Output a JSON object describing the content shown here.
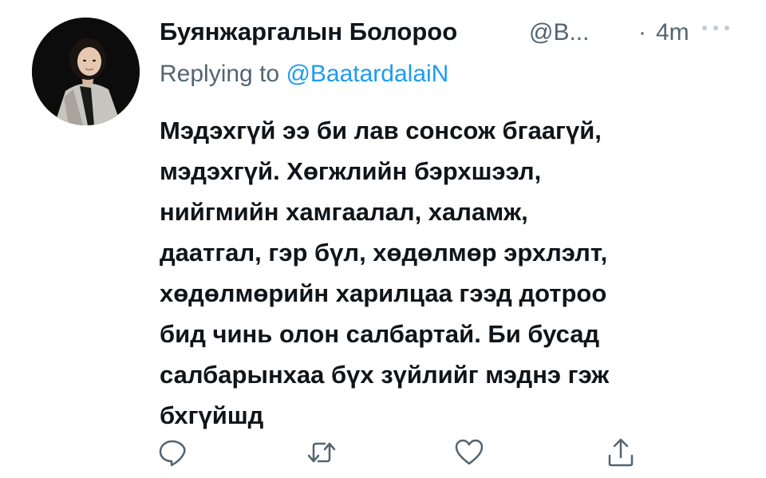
{
  "tweet": {
    "author_name": "Буянжаргалын Болороо",
    "author_handle": "@B...",
    "separator": "·",
    "timestamp": "4m",
    "reply_prefix": "Replying to",
    "reply_to": "@BaatardalaiN",
    "body_lines": [
      "Мэдэхгүй ээ би лав сонсож бгаагүй,",
      "мэдэхгүй. Хөгжлийн бэрхшээл,",
      "нийгмийн хамгаалал, халамж,",
      "даатгал, гэр бүл, хөдөлмөр эрхлэлт,",
      "хөдөлмөрийн харилцаа гээд дотроо",
      "бид чинь олон салбартай. Би бусад",
      "салбарынхаа бүх зүйлийг мэднэ гэж",
      "бхгүйшд"
    ]
  },
  "actions": {
    "reply_icon": "reply-icon",
    "retweet_icon": "retweet-icon",
    "like_icon": "heart-icon",
    "share_icon": "share-icon"
  },
  "colors": {
    "text": "#0f1419",
    "secondary": "#536471",
    "link": "#1d9bf0"
  }
}
